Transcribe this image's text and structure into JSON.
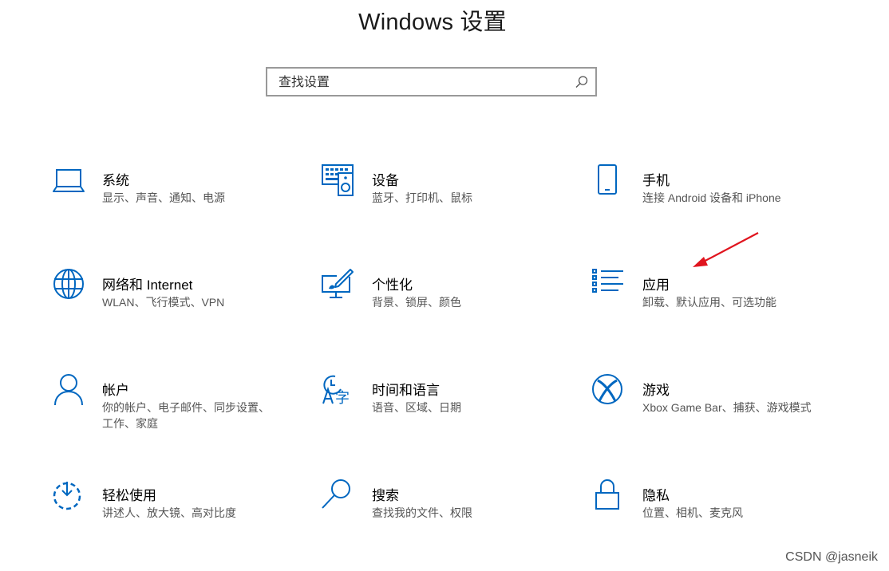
{
  "header": {
    "title": "Windows 设置"
  },
  "search": {
    "placeholder": "查找设置"
  },
  "tiles": [
    {
      "title": "系统",
      "desc": "显示、声音、通知、电源",
      "icon": "laptop-icon"
    },
    {
      "title": "设备",
      "desc": "蓝牙、打印机、鼠标",
      "icon": "devices-icon"
    },
    {
      "title": "手机",
      "desc": "连接 Android 设备和 iPhone",
      "icon": "phone-icon"
    },
    {
      "title": "网络和 Internet",
      "desc": "WLAN、飞行模式、VPN",
      "icon": "globe-icon"
    },
    {
      "title": "个性化",
      "desc": "背景、锁屏、颜色",
      "icon": "personalization-icon"
    },
    {
      "title": "应用",
      "desc": "卸载、默认应用、可选功能",
      "icon": "apps-list-icon"
    },
    {
      "title": "帐户",
      "desc": "你的帐户、电子邮件、同步设置、工作、家庭",
      "icon": "person-icon"
    },
    {
      "title": "时间和语言",
      "desc": "语音、区域、日期",
      "icon": "time-language-icon"
    },
    {
      "title": "游戏",
      "desc": "Xbox Game Bar、捕获、游戏模式",
      "icon": "xbox-icon"
    },
    {
      "title": "轻松使用",
      "desc": "讲述人、放大镜、高对比度",
      "icon": "ease-of-access-icon"
    },
    {
      "title": "搜索",
      "desc": "查找我的文件、权限",
      "icon": "search-icon"
    },
    {
      "title": "隐私",
      "desc": "位置、相机、麦克风",
      "icon": "lock-icon"
    }
  ],
  "watermark": "CSDN @jasneik",
  "colors": {
    "accent": "#0067c0",
    "annotation": "#e0141e"
  }
}
